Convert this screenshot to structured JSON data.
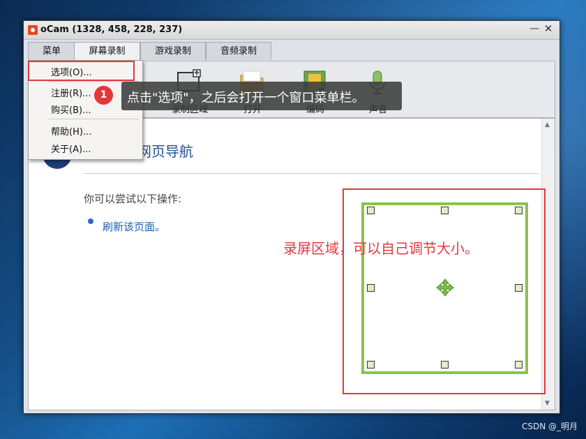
{
  "window": {
    "title": "oCam (1328, 458, 228, 237)",
    "minimize": "—",
    "close": "✕"
  },
  "tabs": [
    {
      "label": "菜单"
    },
    {
      "label": "屏幕录制",
      "active": true
    },
    {
      "label": "游戏录制"
    },
    {
      "label": "音频录制"
    }
  ],
  "toolbar": {
    "items": [
      {
        "label": "录制区域",
        "icon": "record-area-icon"
      },
      {
        "label": "打开",
        "icon": "folder-icon"
      },
      {
        "label": "编码",
        "icon": "film-icon"
      },
      {
        "label": "声音",
        "icon": "microphone-icon"
      }
    ]
  },
  "menu": {
    "items": [
      {
        "label": "选项(O)..."
      },
      {
        "label": "注册(R)..."
      },
      {
        "label": "购买(B)..."
      },
      {
        "label": "帮助(H)..."
      },
      {
        "label": "关于(A)..."
      }
    ]
  },
  "callout": {
    "number": "1",
    "text": "点击\"选项\"，之后会打开一个窗口菜单栏。"
  },
  "content": {
    "nav_title": "网页导航",
    "try_text": "你可以尝试以下操作:",
    "refresh_link": "刷新该页面。"
  },
  "region_label": "录屏区域，可以自己调节大小。",
  "watermark": "CSDN @_明月",
  "colors": {
    "accent_red": "#e0393e",
    "frame_green": "#8bc34a"
  }
}
